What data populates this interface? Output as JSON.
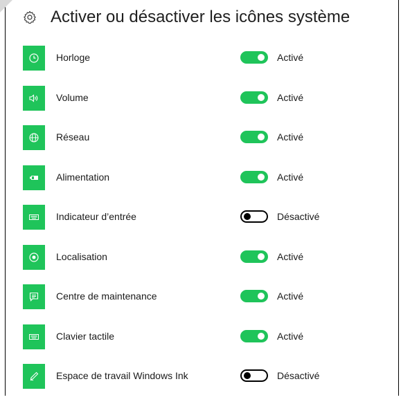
{
  "header": {
    "title": "Activer ou désactiver les icônes système",
    "icon": "gear-icon"
  },
  "colors": {
    "accent": "#1fc45a",
    "text": "#1a1a1a"
  },
  "items": [
    {
      "label": "Horloge",
      "icon": "clock-icon",
      "on": true,
      "state": "Activé"
    },
    {
      "label": "Volume",
      "icon": "volume-icon",
      "on": true,
      "state": "Activé"
    },
    {
      "label": "Réseau",
      "icon": "network-icon",
      "on": true,
      "state": "Activé"
    },
    {
      "label": "Alimentation",
      "icon": "battery-icon",
      "on": true,
      "state": "Activé"
    },
    {
      "label": "Indicateur d’entrée",
      "icon": "keyboard-icon",
      "on": false,
      "state": "Désactivé"
    },
    {
      "label": "Localisation",
      "icon": "location-icon",
      "on": true,
      "state": "Activé"
    },
    {
      "label": "Centre de maintenance",
      "icon": "action-center-icon",
      "on": true,
      "state": "Activé"
    },
    {
      "label": "Clavier tactile",
      "icon": "touch-keyboard-icon",
      "on": true,
      "state": "Activé"
    },
    {
      "label": "Espace de travail Windows Ink",
      "icon": "pen-icon",
      "on": false,
      "state": "Désactivé"
    }
  ]
}
